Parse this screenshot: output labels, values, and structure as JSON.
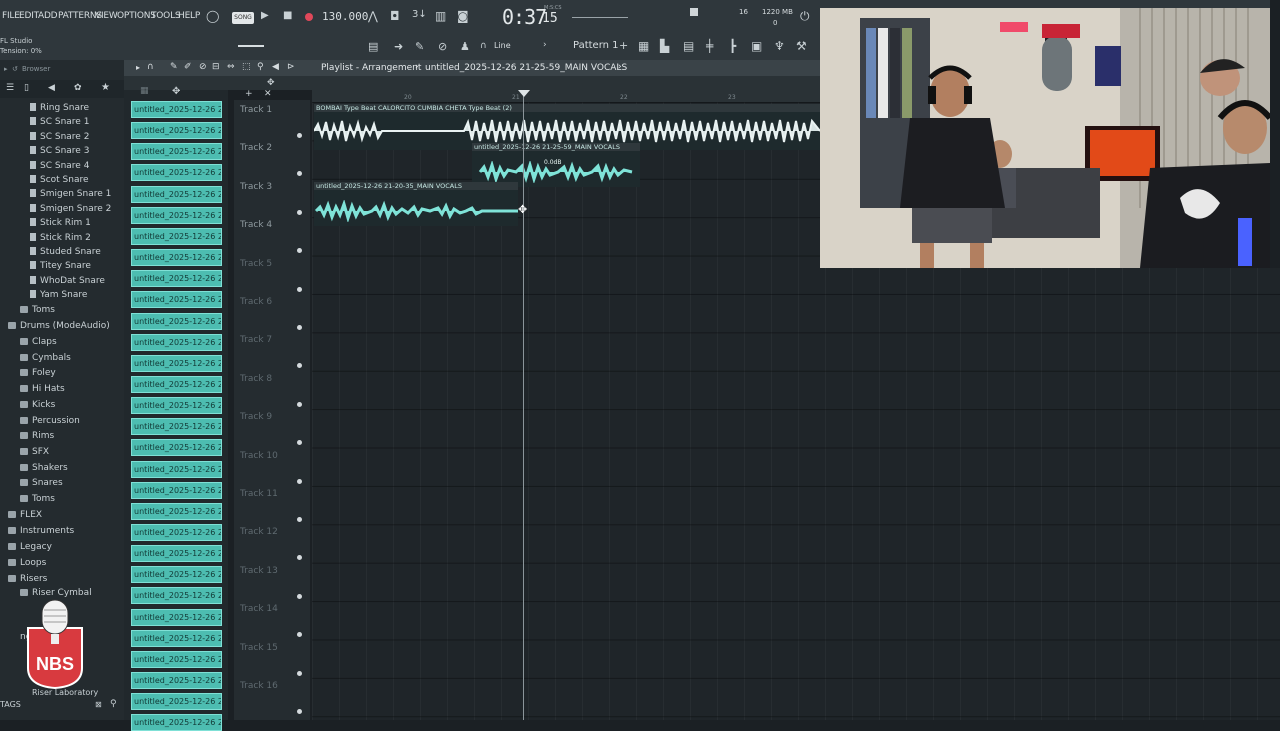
{
  "menu": [
    "FILE",
    "EDIT",
    "ADD",
    "PATTERNS",
    "VIEW",
    "OPTIONS",
    "TOOLS",
    "HELP"
  ],
  "song_label": "SONG",
  "bpm": "130.000",
  "time_main": "0:37",
  "time_ms": "15",
  "time_unit": "M:S:CS",
  "cpu_value": "16",
  "ram_value": "1220 MB",
  "ram_sub": "0",
  "app_hint": {
    "line1": "FL Studio",
    "line2": "Tension:  0%"
  },
  "snap_mode": "Line",
  "pattern_label": "Pattern 1",
  "browser_title": "Browser",
  "playlist_title": "Playlist - Arrangement",
  "playlist_file": "untitled_2025-12-26 21-25-59_MAIN VOCALS",
  "browser_items": [
    {
      "label": "Ring Snare",
      "type": "doc"
    },
    {
      "label": "SC Snare 1",
      "type": "doc"
    },
    {
      "label": "SC Snare 2",
      "type": "doc"
    },
    {
      "label": "SC Snare 3",
      "type": "doc"
    },
    {
      "label": "SC Snare 4",
      "type": "doc"
    },
    {
      "label": "Scot Snare",
      "type": "doc"
    },
    {
      "label": "Smigen Snare 1",
      "type": "doc"
    },
    {
      "label": "Smigen Snare 2",
      "type": "doc"
    },
    {
      "label": "Stick Rim 1",
      "type": "doc"
    },
    {
      "label": "Stick Rim 2",
      "type": "doc"
    },
    {
      "label": "Studed Snare",
      "type": "doc"
    },
    {
      "label": "Titey Snare",
      "type": "doc"
    },
    {
      "label": "WhoDat Snare",
      "type": "doc"
    },
    {
      "label": "Yam Snare",
      "type": "doc"
    },
    {
      "label": "Toms",
      "type": "folder"
    },
    {
      "label": "Drums (ModeAudio)",
      "type": "folder"
    },
    {
      "label": "Claps",
      "type": "folder"
    },
    {
      "label": "Cymbals",
      "type": "folder"
    },
    {
      "label": "Foley",
      "type": "folder"
    },
    {
      "label": "Hi Hats",
      "type": "folder"
    },
    {
      "label": "Kicks",
      "type": "folder"
    },
    {
      "label": "Percussion",
      "type": "folder"
    },
    {
      "label": "Rims",
      "type": "folder"
    },
    {
      "label": "SFX",
      "type": "folder"
    },
    {
      "label": "Shakers",
      "type": "folder"
    },
    {
      "label": "Snares",
      "type": "folder"
    },
    {
      "label": "Toms",
      "type": "folder"
    },
    {
      "label": "FLEX",
      "type": "folder"
    },
    {
      "label": "Instruments",
      "type": "folder"
    },
    {
      "label": "Legacy",
      "type": "folder"
    },
    {
      "label": "Loops",
      "type": "folder"
    },
    {
      "label": "Risers",
      "type": "folder"
    },
    {
      "label": "Riser Cymbal",
      "type": "folder"
    }
  ],
  "browser_partial": [
    "ng",
    "Riser Laboratory"
  ],
  "clip_label": "untitled_2025-12-26 21-...",
  "clip_count": 30,
  "tracks": [
    "Track 1",
    "Track 2",
    "Track 3",
    "Track 4",
    "Track 5",
    "Track 6",
    "Track 7",
    "Track 8",
    "Track 9",
    "Track 10",
    "Track 11",
    "Track 12",
    "Track 13",
    "Track 14",
    "Track 15",
    "Track 16"
  ],
  "ruler": [
    "20",
    "21",
    "22",
    "23"
  ],
  "clips": [
    {
      "label": "BOMBAI Type Beat CALORCITO  CUMBIA CHETA Type Beat (2)"
    },
    {
      "label": "untitled_2025-12-26 21-25-59_MAIN VOCALS",
      "gain": "0.0dB"
    },
    {
      "label": "untitled_2025-12-26 21-20-35_MAIN VOCALS"
    }
  ],
  "tags_label": "TAGS",
  "logo_text": "NBS",
  "colors": {
    "accent": "#4dbdb1",
    "waveform": "#7fe3d8",
    "bg": "#1f2529",
    "toolbar": "#2f373c"
  }
}
